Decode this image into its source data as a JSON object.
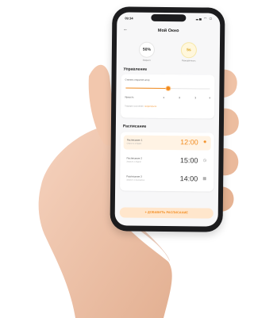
{
  "colors": {
    "accent": "#f28a1c",
    "accent_soft": "#ffe6cc",
    "sun": "#d9a21c",
    "phone_frame": "#1c1c1e",
    "screen_bg": "#f7f7f8"
  },
  "status_bar": {
    "time": "09:34",
    "icons": [
      "signal-icon",
      "wifi-icon",
      "battery-icon"
    ]
  },
  "header": {
    "back_icon": "arrow-left-icon",
    "title": "Мой Окно"
  },
  "gauges": [
    {
      "value": "50%",
      "label": "Закрыто",
      "style": "neutral"
    },
    {
      "value": "5s",
      "label": "Освещённость",
      "style": "sun"
    }
  ],
  "control": {
    "title": "Управление",
    "position_label": "Степень открытия штор",
    "position_percent": 50,
    "scale_label": "Яркость",
    "scale_ticks": [
      "1",
      "2",
      "3",
      "4"
    ],
    "footnote_text": "Текущее состояние:",
    "footnote_link": "полуоткрыто"
  },
  "schedule": {
    "title": "Расписание",
    "items": [
      {
        "name": "Расписание 1",
        "sub": "Открыть в будни",
        "time": "12:00",
        "icon": "sun-icon",
        "active": true
      },
      {
        "name": "Расписание 2",
        "sub": "Закрыть в будни",
        "time": "15:00",
        "icon": "clock-icon",
        "active": false
      },
      {
        "name": "Расписание 3",
        "sub": "Закрыть в выходные",
        "time": "14:00",
        "icon": "calendar-icon",
        "active": false
      }
    ]
  },
  "cta": {
    "label": "+ ДОБАВИТЬ РАСПИСАНИЕ"
  }
}
